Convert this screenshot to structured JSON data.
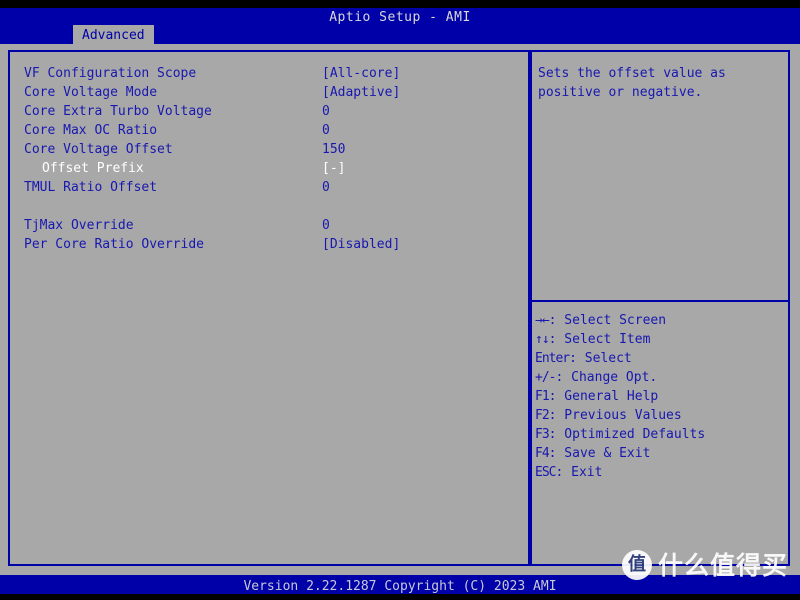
{
  "header": {
    "title": "Aptio Setup - AMI",
    "tab_label": "Advanced"
  },
  "settings": [
    {
      "label": "VF Configuration Scope",
      "value": "[All-core]",
      "indent": false,
      "selected": false,
      "spacer": false
    },
    {
      "label": "Core Voltage Mode",
      "value": "[Adaptive]",
      "indent": false,
      "selected": false,
      "spacer": false
    },
    {
      "label": "Core Extra Turbo Voltage",
      "value": "0",
      "indent": false,
      "selected": false,
      "spacer": false
    },
    {
      "label": "Core Max OC Ratio",
      "value": "0",
      "indent": false,
      "selected": false,
      "spacer": false
    },
    {
      "label": "Core Voltage Offset",
      "value": "150",
      "indent": false,
      "selected": false,
      "spacer": false
    },
    {
      "label": "Offset Prefix",
      "value": "[-]",
      "indent": true,
      "selected": true,
      "spacer": false
    },
    {
      "label": "TMUL Ratio Offset",
      "value": "0",
      "indent": false,
      "selected": false,
      "spacer": false
    },
    {
      "label": "",
      "value": "",
      "indent": false,
      "selected": false,
      "spacer": true
    },
    {
      "label": "TjMax Override",
      "value": "0",
      "indent": false,
      "selected": false,
      "spacer": false
    },
    {
      "label": "Per Core Ratio Override",
      "value": "[Disabled]",
      "indent": false,
      "selected": false,
      "spacer": false
    }
  ],
  "help": {
    "lines": [
      "Sets the offset value as",
      "positive or negative."
    ]
  },
  "keys": [
    {
      "glyph": "→←",
      "text": ": Select Screen"
    },
    {
      "glyph": "↑↓",
      "text": ": Select Item"
    },
    {
      "glyph": "Enter",
      "text": ": Select"
    },
    {
      "glyph": "+/-",
      "text": ": Change Opt."
    },
    {
      "glyph": "F1",
      "text": ": General Help"
    },
    {
      "glyph": "F2",
      "text": ": Previous Values"
    },
    {
      "glyph": "F3",
      "text": ": Optimized Defaults"
    },
    {
      "glyph": "F4",
      "text": ": Save & Exit"
    },
    {
      "glyph": "ESC",
      "text": ": Exit"
    }
  ],
  "footer": {
    "version": "Version 2.22.1287 Copyright (C) 2023 AMI"
  },
  "watermark": {
    "logo_char": "值",
    "text": "什么值得买"
  },
  "colors": {
    "blue": "#0000a8",
    "gray": "#a8a8a8",
    "text_blue": "#1818b0",
    "selected_white": "#ffffff"
  }
}
